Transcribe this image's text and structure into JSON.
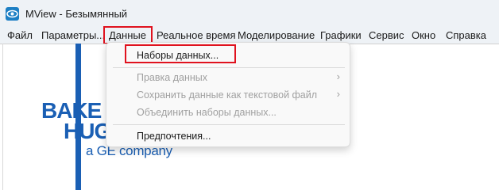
{
  "window": {
    "title": "MView - Безымянный"
  },
  "menubar": {
    "items": [
      "Файл",
      "Параметры...",
      "Данные",
      "Реальное время",
      "Моделирование",
      "Графики",
      "Сервис",
      "Окно",
      "Справка"
    ]
  },
  "dropdown": {
    "datasets": "Наборы данных...",
    "edit_data": "Правка данных",
    "save_text": "Сохранить данные как текстовой файл",
    "merge": "Объединить наборы данных...",
    "preferences": "Предпочтения..."
  },
  "logo": {
    "word1": "BAKE",
    "word2": "HUG",
    "tagline": "a GE company"
  },
  "colors": {
    "highlight": "#e0121e",
    "logo_blue": "#1a5fb4",
    "app_icon": "#1d7fc4"
  }
}
